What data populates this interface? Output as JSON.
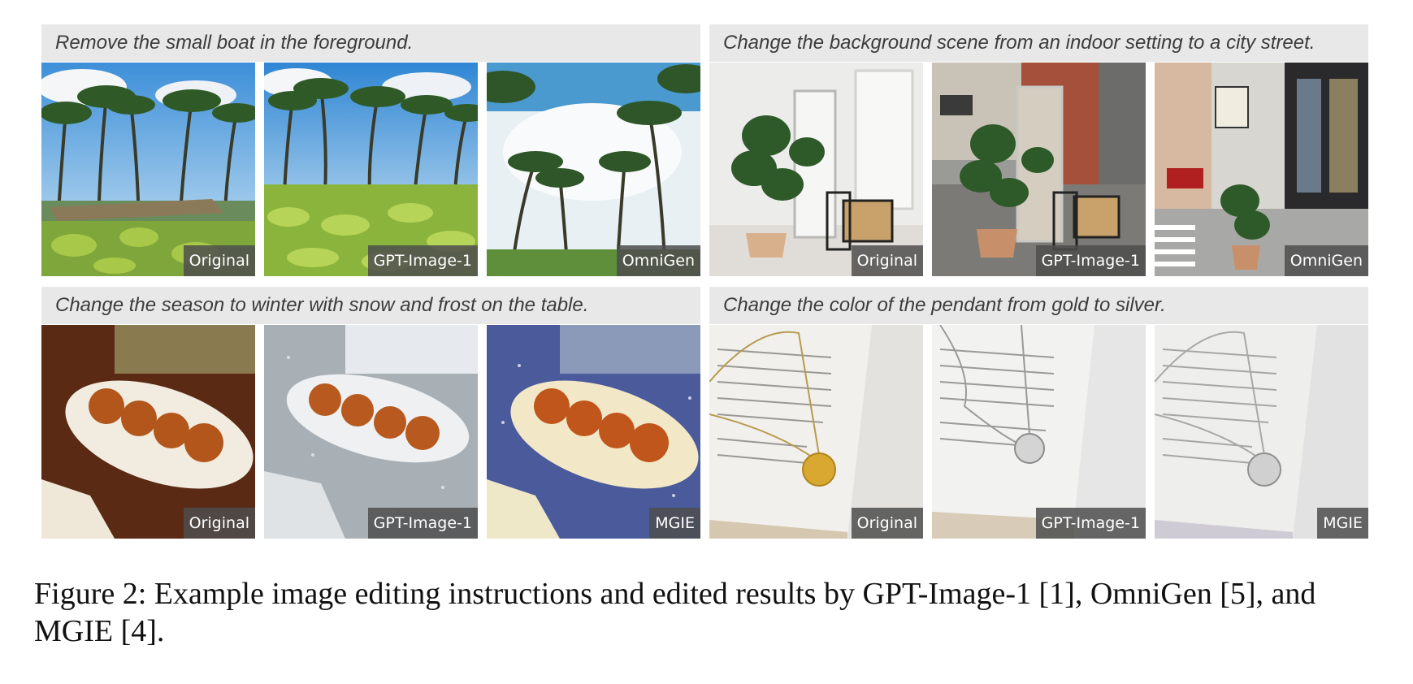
{
  "panels": [
    {
      "instruction": "Remove the small boat in the foreground.",
      "images": [
        {
          "label": "Original",
          "scene": "palm trees on a beach with a small boat in the foreground"
        },
        {
          "label": "GPT-Image-1",
          "scene": "palm trees with green foreground, boat removed"
        },
        {
          "label": "OmniGen",
          "scene": "upward view of palm trees against a bright sky"
        }
      ]
    },
    {
      "instruction": "Change the background scene from an indoor setting to a city street.",
      "images": [
        {
          "label": "Original",
          "scene": "potted plant and mirror in a white room"
        },
        {
          "label": "GPT-Image-1",
          "scene": "potted plant and mirror on a brick city street"
        },
        {
          "label": "OmniGen",
          "scene": "city street with shops and a potted plant"
        }
      ]
    },
    {
      "instruction": "Change the season to winter with snow and frost on the table.",
      "images": [
        {
          "label": "Original",
          "scene": "plate of four fried balls on a wooden table"
        },
        {
          "label": "GPT-Image-1",
          "scene": "plate of fried balls on a frosty grey table"
        },
        {
          "label": "MGIE",
          "scene": "plate of fried balls with blue snowy tint"
        }
      ]
    },
    {
      "instruction": "Change the color of the pendant from gold to silver.",
      "images": [
        {
          "label": "Original",
          "scene": "gold coin pendant on an open book"
        },
        {
          "label": "GPT-Image-1",
          "scene": "silver coin pendant on an open book"
        },
        {
          "label": "MGIE",
          "scene": "silver coin pendant on an open book, faded"
        }
      ]
    }
  ],
  "caption": "Figure 2: Example image editing instructions and edited results by GPT-Image-1 [1], OmniGen [5], and MGIE [4]."
}
